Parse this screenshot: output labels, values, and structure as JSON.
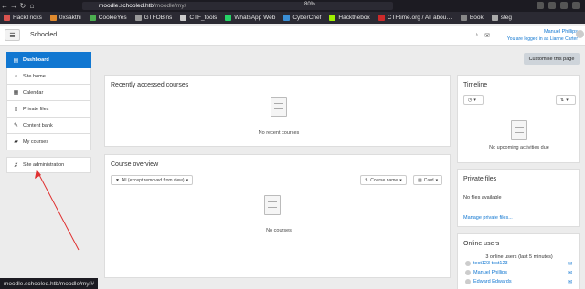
{
  "browser": {
    "url_host": "moodle.schooled.htb",
    "url_path": "/moodle/my/",
    "zoom": "80%",
    "bookmarks": [
      {
        "label": "HackTricks",
        "color": "#d9534f"
      },
      {
        "label": "0xsakthi",
        "color": "#e08a2e"
      },
      {
        "label": "CookieYes",
        "color": "#4caf50"
      },
      {
        "label": "GTFOBins",
        "color": "#999999"
      },
      {
        "label": "CTF_tools",
        "color": "#cccccc"
      },
      {
        "label": "WhatsApp Web",
        "color": "#25d366"
      },
      {
        "label": "CyberChef",
        "color": "#3a8fd6"
      },
      {
        "label": "Hackthebox",
        "color": "#9fef00"
      },
      {
        "label": "CTFtime.org / All abou…",
        "color": "#cc2a2a"
      },
      {
        "label": "Book",
        "color": "#888888"
      },
      {
        "label": "steg",
        "color": "#aaaaaa"
      }
    ],
    "status_url": "moodle.schooled.htb/moodle/my/#"
  },
  "header": {
    "menu_icon": "hamburger-icon",
    "site_name": "Schooled",
    "user_name": "Manuel Phillips",
    "logged_in_as": "You are logged in as Lianne Carter"
  },
  "drawer": {
    "items": [
      {
        "label": "Dashboard",
        "icon": "dashboard-icon",
        "glyph": "▤"
      },
      {
        "label": "Site home",
        "icon": "home-icon",
        "glyph": "⌂"
      },
      {
        "label": "Calendar",
        "icon": "calendar-icon",
        "glyph": "▦"
      },
      {
        "label": "Private files",
        "icon": "file-icon",
        "glyph": "▯"
      },
      {
        "label": "Content bank",
        "icon": "brush-icon",
        "glyph": "✎"
      },
      {
        "label": "My courses",
        "icon": "graduation-cap-icon",
        "glyph": "▰"
      },
      {
        "label": "Site administration",
        "icon": "wrench-icon",
        "glyph": "✗"
      }
    ]
  },
  "main": {
    "customise_label": "Customise this page",
    "recent": {
      "title": "Recently accessed courses",
      "empty": "No recent courses"
    },
    "overview": {
      "title": "Course overview",
      "filter": "All (except removed from view)",
      "sort": "Course name",
      "view": "Card",
      "empty": "No courses"
    }
  },
  "timeline": {
    "title": "Timeline",
    "empty": "No upcoming activities due"
  },
  "private_files": {
    "title": "Private files",
    "empty": "No files available",
    "manage": "Manage private files..."
  },
  "online_users": {
    "title": "Online users",
    "summary": "3 online users (last 5 minutes)",
    "users": [
      "test123 test123",
      "Manuel Phillips",
      "Edward Edwards"
    ]
  },
  "colors": {
    "accent": "#1177d1",
    "annotation_arrow": "#e03030"
  }
}
